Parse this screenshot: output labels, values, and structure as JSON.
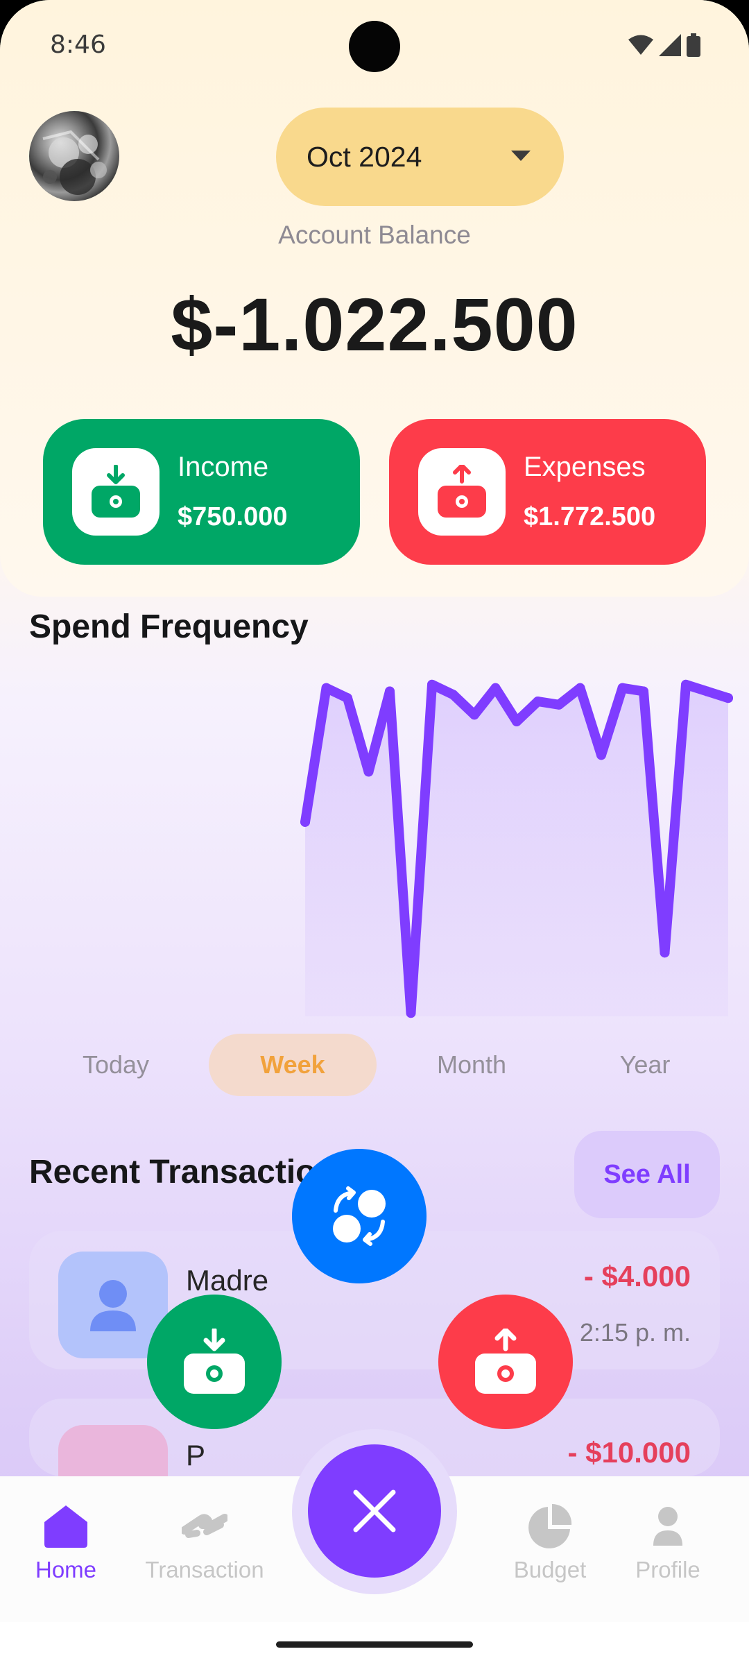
{
  "status_bar": {
    "time": "8:46"
  },
  "header": {
    "month_selector": "Oct 2024",
    "balance_label": "Account Balance",
    "balance_value": "$-1.022.500"
  },
  "cards": {
    "income": {
      "title": "Income",
      "amount": "$750.000",
      "color": "#00A766"
    },
    "expenses": {
      "title": "Expenses",
      "amount": "$1.772.500",
      "color": "#FD3C4A"
    }
  },
  "spend_frequency": {
    "title": "Spend Frequency",
    "tabs": [
      "Today",
      "Week",
      "Month",
      "Year"
    ],
    "active_tab": "Week"
  },
  "chart_data": {
    "type": "area",
    "line_color": "#7F3DFF",
    "values": [
      0.58,
      0.98,
      0.95,
      0.73,
      0.97,
      0.01,
      0.99,
      0.96,
      0.9,
      0.98,
      0.88,
      0.94,
      0.93,
      0.98,
      0.78,
      0.98,
      0.97,
      0.19,
      0.99,
      0.97,
      0.95
    ]
  },
  "recent_transactions": {
    "title": "Recent Transaction",
    "see_all": "See All",
    "items": [
      {
        "name": "Madre",
        "amount": "- $4.000",
        "time": "2:15 p. m.",
        "icon": "person-icon"
      },
      {
        "name": "P",
        "amount": "- $10.000",
        "time": "",
        "icon": "category-icon"
      }
    ]
  },
  "quick_actions": [
    {
      "name": "transfer",
      "color": "#0077FF",
      "icon": "transfer-icon"
    },
    {
      "name": "income",
      "color": "#00A766",
      "icon": "income-icon"
    },
    {
      "name": "expense",
      "color": "#FD3C4A",
      "icon": "expense-icon"
    }
  ],
  "bottom_nav": {
    "home": "Home",
    "transaction": "Transaction",
    "budget": "Budget",
    "profile": "Profile",
    "active": "Home",
    "accent": "#7F3DFF"
  }
}
